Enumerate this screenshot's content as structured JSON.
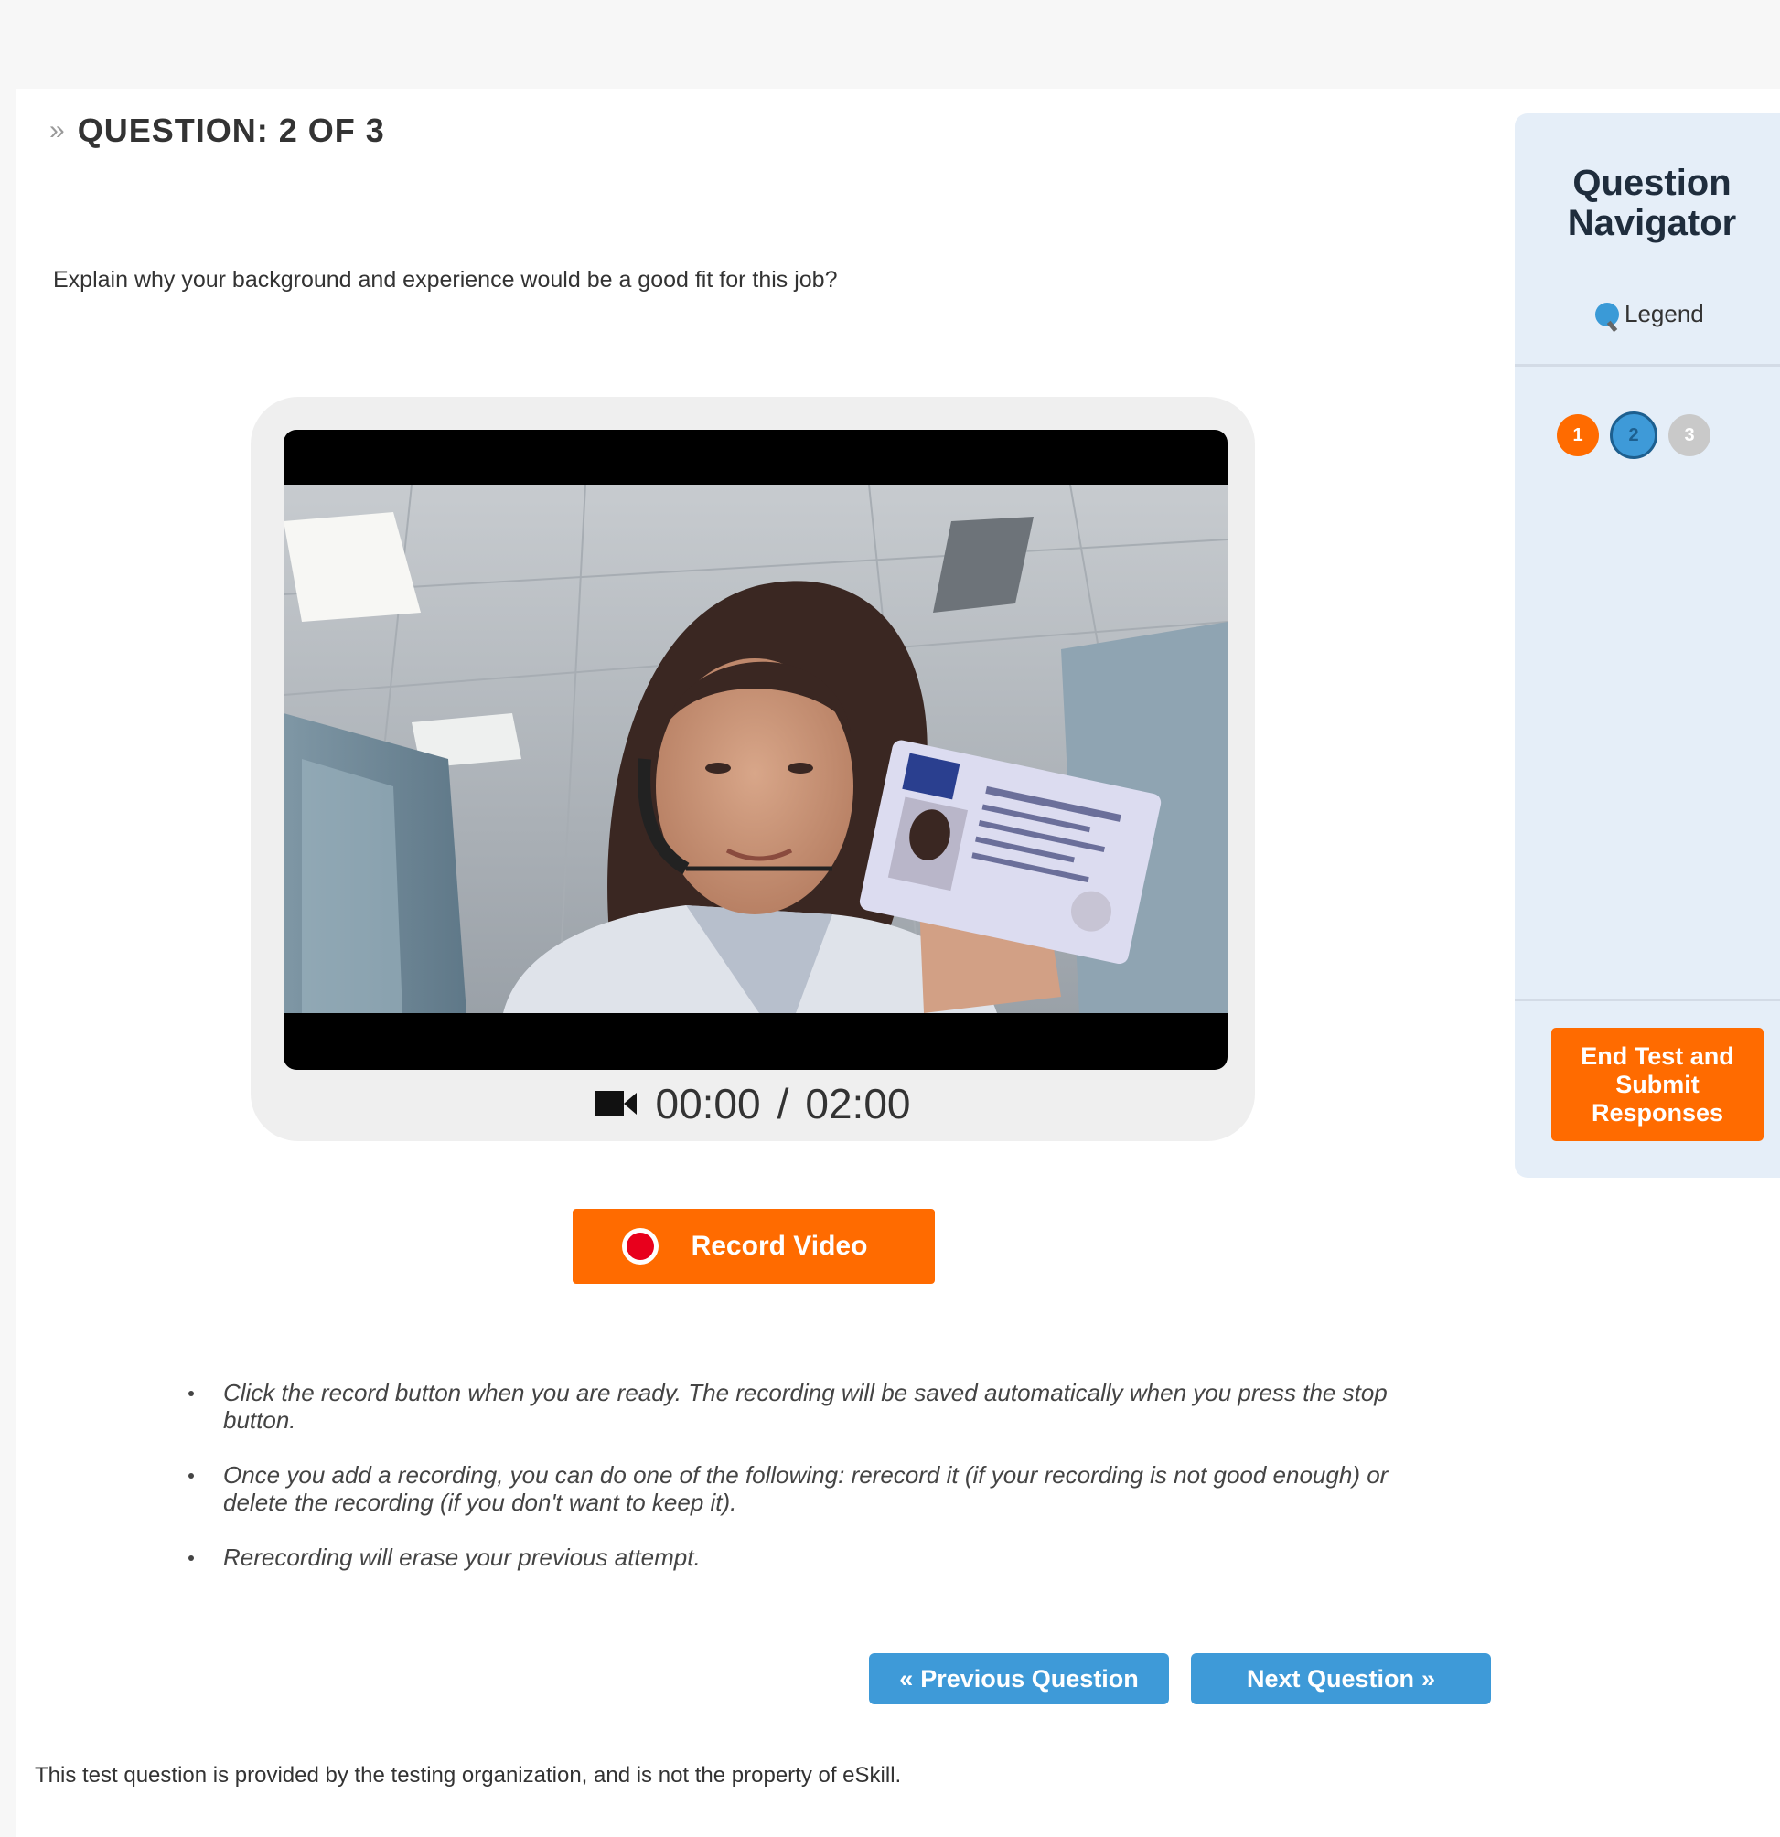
{
  "question": {
    "header": "QUESTION: 2 OF 3",
    "text": "Explain why your background and experience would be a good fit for this job?"
  },
  "video": {
    "elapsed": "00:00",
    "separator": "/",
    "limit": "02:00"
  },
  "record_button_label": "Record Video",
  "instructions": [
    "Click the record button when you are ready. The recording will be saved automatically when you press the stop button.",
    "Once you add a recording, you can do one of the following: rerecord it (if your recording is not good enough) or delete the recording (if you don't want to keep it).",
    "Rerecording will erase your previous attempt."
  ],
  "nav": {
    "previous_label": "Previous Question",
    "next_label": "Next Question"
  },
  "disclaimer": "This test question is provided by the testing organization, and is not the property of eSkill.",
  "navigator": {
    "title": "Question Navigator",
    "legend_label": "Legend",
    "questions": [
      {
        "number": "1",
        "status_color": "#ff6b00"
      },
      {
        "number": "2",
        "status_color": "#3e9ad8"
      },
      {
        "number": "3",
        "status_color": "#c9c9c9"
      }
    ],
    "end_button_label": "End Test and Submit Responses"
  },
  "colors": {
    "accent_orange": "#ff6b00",
    "accent_blue": "#3e9ad8",
    "panel_bg": "#e5eef8"
  }
}
